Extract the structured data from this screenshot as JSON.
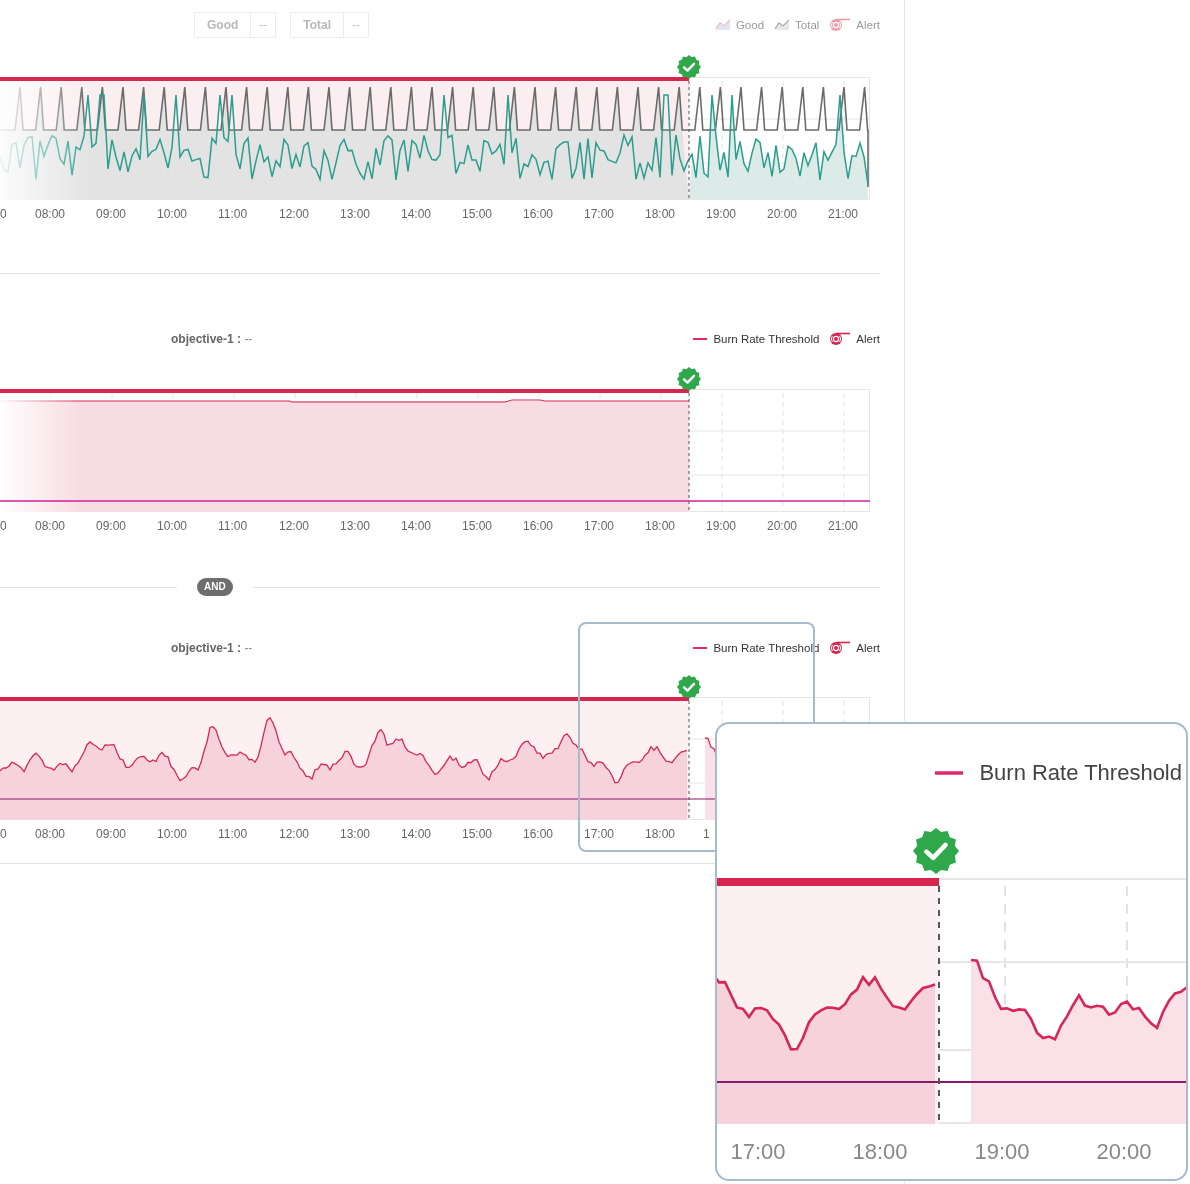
{
  "panels": [
    {
      "kind": "good-total",
      "filters": [
        {
          "label": "Good",
          "value": "--"
        },
        {
          "label": "Total",
          "value": "--"
        }
      ],
      "legend": [
        {
          "kind": "area",
          "label": "Good",
          "disabled": true
        },
        {
          "kind": "line",
          "label": "Total",
          "disabled": true
        },
        {
          "kind": "alert",
          "label": "Alert",
          "disabled": true
        }
      ],
      "x_ticks": [
        "0",
        "08:00",
        "09:00",
        "10:00",
        "11:00",
        "12:00",
        "13:00",
        "14:00",
        "15:00",
        "16:00",
        "17:00",
        "18:00",
        "19:00",
        "20:00",
        "21:00"
      ]
    },
    {
      "kind": "burn-rate",
      "objective": {
        "label": "objective-1 :",
        "value": "--"
      },
      "legend": [
        {
          "kind": "threshold",
          "label": "Burn Rate Threshold",
          "disabled": false
        },
        {
          "kind": "alert",
          "label": "Alert",
          "disabled": false
        }
      ],
      "x_ticks": [
        "0",
        "08:00",
        "09:00",
        "10:00",
        "11:00",
        "12:00",
        "13:00",
        "14:00",
        "15:00",
        "16:00",
        "17:00",
        "18:00",
        "19:00",
        "20:00",
        "21:00"
      ]
    },
    {
      "kind": "burn-rate",
      "operator": "AND",
      "objective": {
        "label": "objective-1 :",
        "value": "--"
      },
      "legend": [
        {
          "kind": "threshold",
          "label": "Burn Rate Threshold",
          "disabled": false
        },
        {
          "kind": "alert",
          "label": "Alert",
          "disabled": false
        }
      ],
      "x_ticks": [
        "0",
        "08:00",
        "09:00",
        "10:00",
        "11:00",
        "12:00",
        "13:00",
        "14:00",
        "15:00",
        "16:00",
        "17:00",
        "18:00",
        "1"
      ]
    }
  ],
  "magnifier": {
    "legend_label": "Burn Rate Threshold",
    "x_ticks": [
      "17:00",
      "18:00",
      "19:00",
      "20:00"
    ]
  }
}
